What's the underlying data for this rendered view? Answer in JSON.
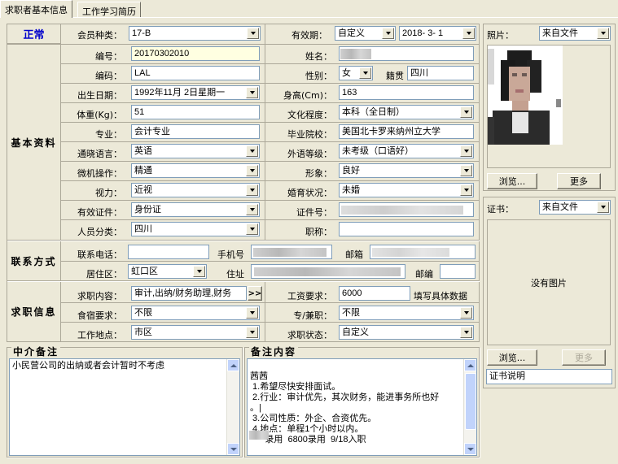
{
  "tabs": [
    {
      "label": "求职者基本信息",
      "active": true
    },
    {
      "label": "工作学习简历",
      "active": false
    }
  ],
  "status": {
    "label": "正常",
    "color": "#0000cc"
  },
  "membership": {
    "label": "会员种类：",
    "value": "17-B"
  },
  "validity": {
    "label": "有效期：",
    "type": "自定义",
    "date": "2018- 3- 1"
  },
  "sections": {
    "basic": "基本资料",
    "contact": "联系方式",
    "job": "求职信息"
  },
  "basic": {
    "number": {
      "label": "编号：",
      "value": "20170302010"
    },
    "code": {
      "label": "编码：",
      "value": "LAL"
    },
    "birth": {
      "label": "出生日期：",
      "value": "1992年11月 2日星期一"
    },
    "weight": {
      "label": "体重(Kg)：",
      "value": "51"
    },
    "major": {
      "label": "专业：",
      "value": "会计专业"
    },
    "language": {
      "label": "通晓语言：",
      "value": "英语"
    },
    "computer": {
      "label": "微机操作：",
      "value": "精通"
    },
    "vision": {
      "label": "视力：",
      "value": "近视"
    },
    "id_doc": {
      "label": "有效证件：",
      "value": "身份证"
    },
    "category": {
      "label": "人员分类：",
      "value": "四川"
    },
    "name": {
      "label": "姓名：",
      "value": ""
    },
    "gender": {
      "label": "性别：",
      "value": "女"
    },
    "native": {
      "label": "籍贯",
      "value": "四川"
    },
    "height": {
      "label": "身高(Cm)：",
      "value": "163"
    },
    "education": {
      "label": "文化程度：",
      "value": "本科（全日制）"
    },
    "school": {
      "label": "毕业院校：",
      "value": "美国北卡罗来纳州立大学"
    },
    "foreign_level": {
      "label": "外语等级：",
      "value": "未考级（口语好）"
    },
    "image": {
      "label": "形象：",
      "value": "良好"
    },
    "marriage": {
      "label": "婚育状况：",
      "value": "未婚"
    },
    "id_number": {
      "label": "证件号：",
      "value": ""
    },
    "title": {
      "label": "职称：",
      "value": ""
    }
  },
  "contact": {
    "phone": {
      "label": "联系电话：",
      "value": ""
    },
    "mobile": {
      "label": "手机号",
      "value": ""
    },
    "email": {
      "label": "邮箱",
      "value": ""
    },
    "district": {
      "label": "居住区：",
      "value": "虹口区"
    },
    "address": {
      "label": "住址",
      "value": ""
    },
    "zip": {
      "label": "邮编",
      "value": ""
    }
  },
  "job": {
    "content": {
      "label": "求职内容：",
      "value": "审计,出纳/财务助理,财务",
      "more": ">>"
    },
    "salary": {
      "label": "工资要求：",
      "value": "6000",
      "hint": "填写具体数据"
    },
    "board": {
      "label": "食宿要求：",
      "value": "不限"
    },
    "fulltime": {
      "label": "专/兼职：",
      "value": "不限"
    },
    "location": {
      "label": "工作地点：",
      "value": "市区"
    },
    "state": {
      "label": "求职状态：",
      "value": "自定义"
    }
  },
  "agent_notes": {
    "title": "中介备注",
    "text": "小民营公司的出纳或者会计暂时不考虑"
  },
  "remarks": {
    "title": "备注内容",
    "lines": [
      "茜茜",
      " 1.希望尽快安排面试。",
      " 2.行业：审计优先，其次财务，能进事务所也好",
      "。|",
      " 3.公司性质：外企、合资优先。",
      " 4.地点：单程1个小时以内。",
      "",
      "      录用  6800录用  9/18入职"
    ]
  },
  "photo": {
    "label": "照片：",
    "source": "来自文件",
    "browse": "浏览...",
    "more": "更多"
  },
  "certificate": {
    "label": "证书：",
    "source": "来自文件",
    "empty": "没有图片",
    "browse": "浏览...",
    "more": "更多",
    "desc": "证书说明"
  }
}
